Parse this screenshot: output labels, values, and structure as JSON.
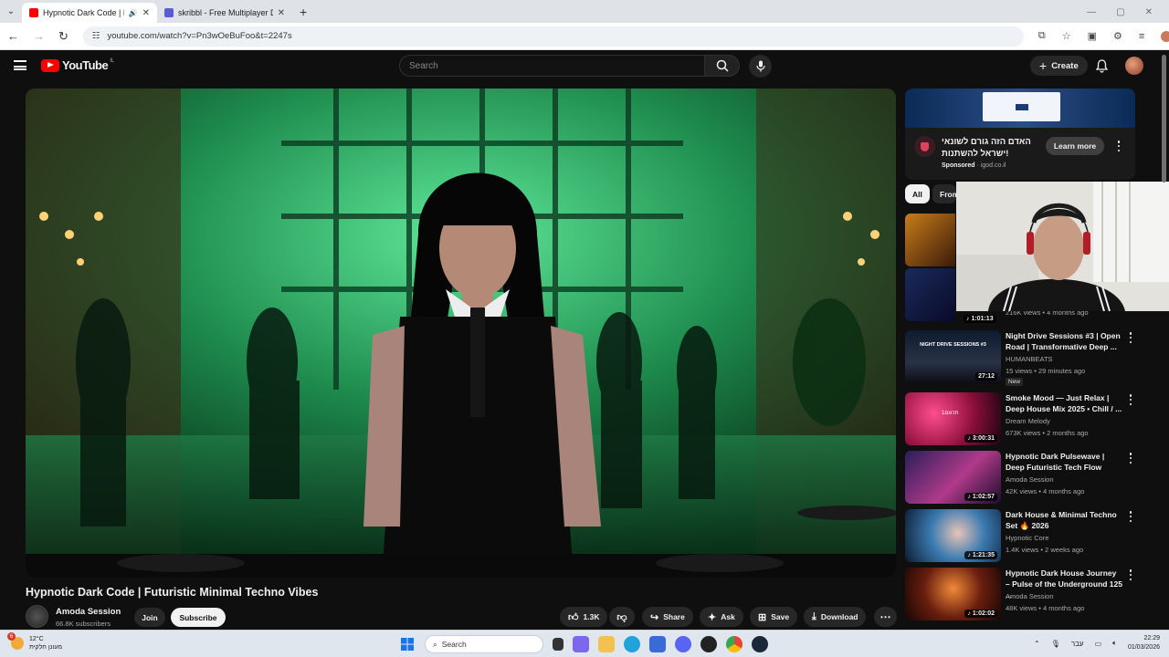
{
  "browser": {
    "tabs": [
      {
        "title": "Hypnotic Dark Code | Futuri",
        "active": true
      },
      {
        "title": "skribbl - Free Multiplayer Drawi",
        "active": false
      }
    ],
    "url": "youtube.com/watch?v=Pn3wOeBuFoo&t=2247s"
  },
  "header": {
    "logo_text": "YouTube",
    "logo_country": "IL",
    "search_placeholder": "Search",
    "create_label": "Create"
  },
  "video": {
    "title": "Hypnotic Dark Code | Futuristic Minimal Techno Vibes",
    "channel": "Amoda Session",
    "subscribers": "66.8K subscribers",
    "join_label": "Join",
    "subscribe_label": "Subscribe",
    "likes": "1.3K",
    "share_label": "Share",
    "ask_label": "Ask",
    "save_label": "Save",
    "download_label": "Download"
  },
  "ad": {
    "line1": "האדם הזה גורם לשונאי",
    "line2": "ישראל להשתנות!",
    "sponsored": "Sponsored",
    "domain": "· igod.co.il",
    "cta": "Learn more"
  },
  "chips": [
    "All",
    "From"
  ],
  "partial_item": {
    "duration": "1:01:13",
    "meta": "216K views • 4 months ago"
  },
  "recommendations": [
    {
      "title": "Night Drive Sessions #3 | Open Road | Transformative Deep ...",
      "channel": "HUMANBEATS",
      "meta": "15 views • 29 minutes ago",
      "duration": "27:12",
      "badge": "New",
      "thumb_text": "NIGHT DRIVE SESSIONS #3"
    },
    {
      "title": "Smoke Mood — Just Relax | Deep House Mix 2025 • Chill / ...",
      "channel": "Dream Melody",
      "meta": "673K views • 2 months ago",
      "duration": "3:00:31",
      "thumb_text": "תרגום1"
    },
    {
      "title": "Hypnotic Dark Pulsewave | Deep Futuristic Tech Flow",
      "channel": "Amoda Session",
      "meta": "42K views • 4 months ago",
      "duration": "1:02:57"
    },
    {
      "title": "Dark House & Minimal Techno Set 🔥 2026",
      "channel": "Hypnotic Core",
      "meta": "1.4K views • 2 weeks ago",
      "duration": "1:21:35"
    },
    {
      "title": "Hypnotic Dark House Journey – Pulse of the Underground 125 ...",
      "channel": "Amoda Session",
      "meta": "48K views • 4 months ago",
      "duration": "1:02:02"
    }
  ],
  "taskbar": {
    "notif_count": "6",
    "temperature": "12°C",
    "weather_desc": "מעונן חלקית",
    "search_label": "Search",
    "lang": "עבר",
    "time": "22:29",
    "date": "01/03/2026"
  },
  "colors": {
    "yt_red": "#ff0000",
    "bg": "#0f0f0f",
    "chip": "#272727"
  }
}
